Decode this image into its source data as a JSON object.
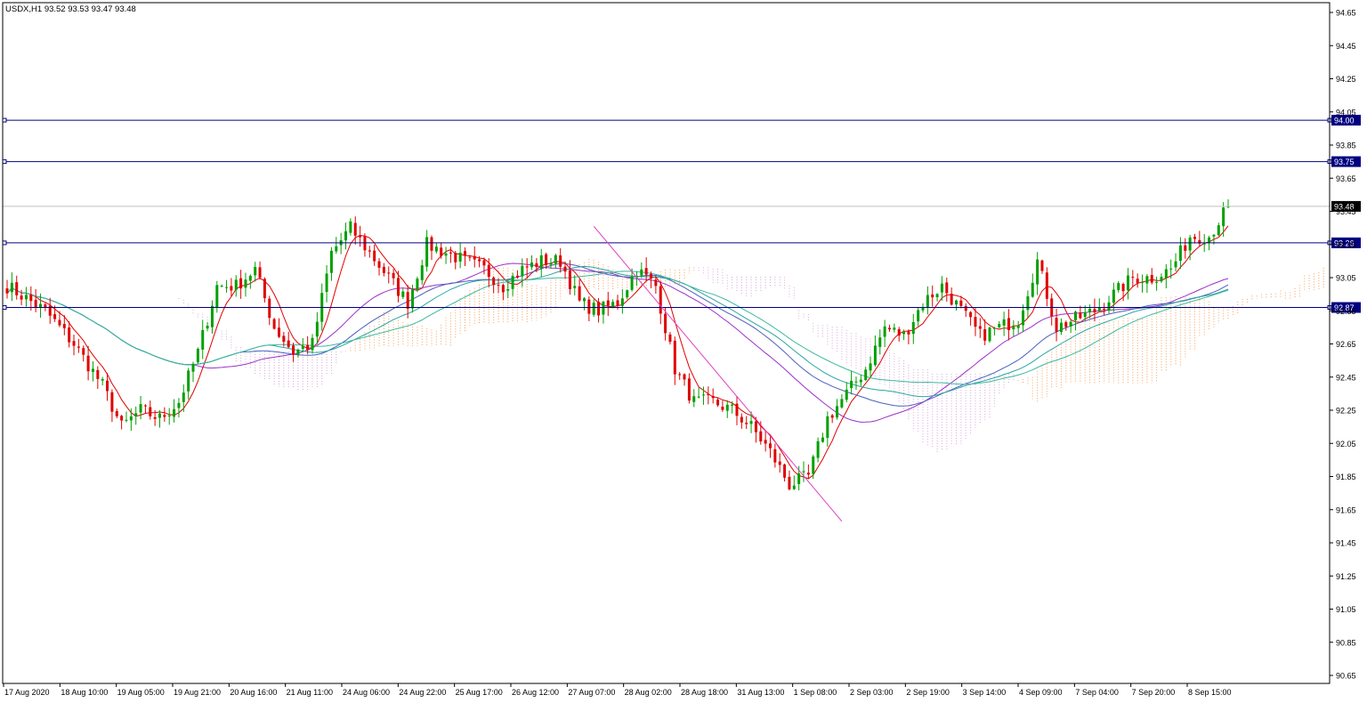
{
  "chart_data": {
    "type": "candlestick",
    "title": "USDX,H1  93.52 93.53 93.47 93.48",
    "ylim": [
      90.6,
      94.72
    ],
    "y_ticks": [
      "94.65",
      "94.45",
      "94.25",
      "94.05",
      "93.85",
      "93.65",
      "93.45",
      "93.25",
      "93.05",
      "92.85",
      "92.65",
      "92.45",
      "92.25",
      "92.05",
      "91.85",
      "91.65",
      "91.45",
      "91.25",
      "91.05",
      "90.85",
      "90.65"
    ],
    "x_labels": [
      "17 Aug 2020",
      "18 Aug 10:00",
      "19 Aug 05:00",
      "19 Aug 21:00",
      "20 Aug 16:00",
      "21 Aug 11:00",
      "24 Aug 06:00",
      "24 Aug 22:00",
      "25 Aug 17:00",
      "26 Aug 12:00",
      "27 Aug 07:00",
      "28 Aug 02:00",
      "28 Aug 18:00",
      "31 Aug 13:00",
      "1 Sep 08:00",
      "2 Sep 03:00",
      "2 Sep 19:00",
      "3 Sep 14:00",
      "4 Sep 09:00",
      "7 Sep 04:00",
      "7 Sep 20:00",
      "8 Sep 15:00"
    ],
    "horizontal_levels": [
      {
        "value": 94.0,
        "label": "94.00"
      },
      {
        "value": 93.75,
        "label": "93.75"
      },
      {
        "value": 93.26,
        "label": "93.26"
      },
      {
        "value": 92.87,
        "label": "92.87"
      }
    ],
    "current_price": {
      "value": 93.48,
      "label": "93.48"
    },
    "close_path": [
      [
        0,
        93.0
      ],
      [
        8,
        92.85
      ],
      [
        14,
        92.65
      ],
      [
        20,
        92.4
      ],
      [
        24,
        92.15
      ],
      [
        28,
        92.25
      ],
      [
        32,
        92.2
      ],
      [
        36,
        92.3
      ],
      [
        40,
        92.6
      ],
      [
        44,
        93.0
      ],
      [
        48,
        93.0
      ],
      [
        52,
        93.1
      ],
      [
        56,
        92.75
      ],
      [
        60,
        92.6
      ],
      [
        64,
        92.65
      ],
      [
        68,
        93.2
      ],
      [
        72,
        93.35
      ],
      [
        76,
        93.2
      ],
      [
        80,
        93.05
      ],
      [
        84,
        92.9
      ],
      [
        88,
        93.25
      ],
      [
        92,
        93.2
      ],
      [
        96,
        93.15
      ],
      [
        100,
        93.1
      ],
      [
        104,
        93.0
      ],
      [
        108,
        93.1
      ],
      [
        112,
        93.15
      ],
      [
        116,
        93.15
      ],
      [
        120,
        92.9
      ],
      [
        124,
        92.85
      ],
      [
        128,
        92.9
      ],
      [
        132,
        93.1
      ],
      [
        136,
        93.0
      ],
      [
        140,
        92.5
      ],
      [
        144,
        92.3
      ],
      [
        148,
        92.3
      ],
      [
        152,
        92.25
      ],
      [
        156,
        92.15
      ],
      [
        160,
        92.0
      ],
      [
        164,
        91.8
      ],
      [
        168,
        91.85
      ],
      [
        172,
        92.2
      ],
      [
        176,
        92.35
      ],
      [
        180,
        92.5
      ],
      [
        184,
        92.75
      ],
      [
        188,
        92.7
      ],
      [
        192,
        92.9
      ],
      [
        196,
        93.0
      ],
      [
        200,
        92.85
      ],
      [
        204,
        92.7
      ],
      [
        208,
        92.75
      ],
      [
        212,
        92.8
      ],
      [
        216,
        93.15
      ],
      [
        220,
        92.75
      ],
      [
        224,
        92.8
      ],
      [
        228,
        92.85
      ],
      [
        232,
        92.95
      ],
      [
        236,
        93.05
      ],
      [
        240,
        93.05
      ],
      [
        244,
        93.1
      ],
      [
        248,
        93.3
      ],
      [
        252,
        93.3
      ],
      [
        256,
        93.48
      ]
    ],
    "bar_count": 257,
    "indicators": [
      {
        "type": "moving_average",
        "period": 6,
        "color": "#e00000"
      },
      {
        "type": "moving_average",
        "period": 40,
        "color": "#9b30c8"
      },
      {
        "type": "moving_average",
        "period": 50,
        "color": "#4a5fc1"
      },
      {
        "type": "moving_average",
        "period": 56,
        "color": "#2aa5a0"
      },
      {
        "type": "moving_average",
        "period": 64,
        "color": "#3cb89e"
      },
      {
        "type": "ichimoku_cloud",
        "up_color": "#f5a05c",
        "down_color": "#d8a8d8"
      },
      {
        "type": "trendline",
        "from_bar": 123,
        "from_price": 93.36,
        "to_bar": 175,
        "to_price": 91.58,
        "color": "#e040c0"
      }
    ],
    "colors": {
      "bull": "#00a000",
      "bear": "#e00000",
      "level_line": "#000080",
      "tag_bg": "#000080",
      "price_tag_bg": "#000000",
      "grid_line": "#c0c0c0"
    }
  }
}
